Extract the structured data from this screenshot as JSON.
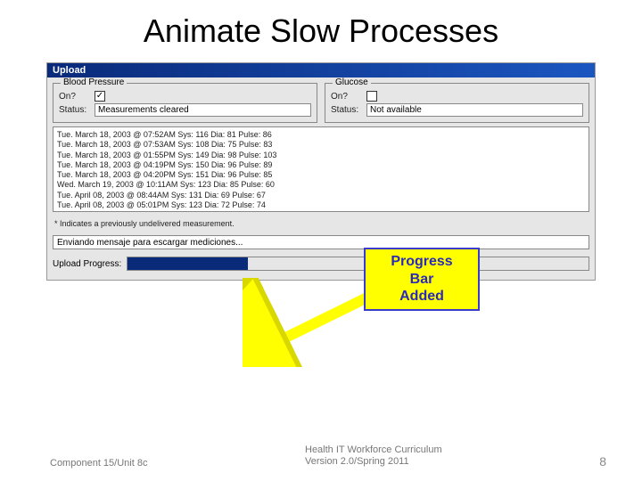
{
  "slide": {
    "title": "Animate Slow Processes"
  },
  "window": {
    "title": "Upload"
  },
  "bp_panel": {
    "legend": "Blood Pressure",
    "on_label": "On?",
    "on_checked": "✓",
    "status_label": "Status:",
    "status_value": "Measurements cleared"
  },
  "glucose_panel": {
    "legend": "Glucose",
    "on_label": "On?",
    "on_checked": "",
    "status_label": "Status:",
    "status_value": "Not available"
  },
  "readings": [
    "Tue. March 18, 2003 @ 07:52AM Sys: 116 Dia: 81 Pulse: 86",
    "Tue. March 18, 2003 @ 07:53AM Sys: 108 Dia: 75 Pulse: 83",
    "Tue. March 18, 2003 @ 01:55PM Sys: 149 Dia: 98 Pulse: 103",
    "Tue. March 18, 2003 @ 04:19PM Sys: 150 Dia: 96 Pulse: 89",
    "Tue. March 18, 2003 @ 04:20PM Sys: 151 Dia: 96 Pulse: 85",
    "Wed. March 19, 2003 @ 10:11AM Sys: 123 Dia: 85 Pulse: 60",
    "Tue. April 08, 2003 @ 08:44AM Sys: 131 Dia: 69 Pulse: 67",
    "Tue. April 08, 2003 @ 05:01PM Sys: 123 Dia: 72 Pulse: 74"
  ],
  "note_text": "* Indicates a previously undelivered measurement.",
  "upload_msg": "Enviando mensaje para escargar mediciones...",
  "progress_label": "Upload Progress:",
  "callout_l1": "Progress",
  "callout_l2": "Bar",
  "callout_l3": "Added",
  "footer": {
    "left": "Component 15/Unit 8c",
    "center_l1": "Health IT Workforce Curriculum",
    "center_l2": "Version 2.0/Spring 2011",
    "right": "8"
  }
}
